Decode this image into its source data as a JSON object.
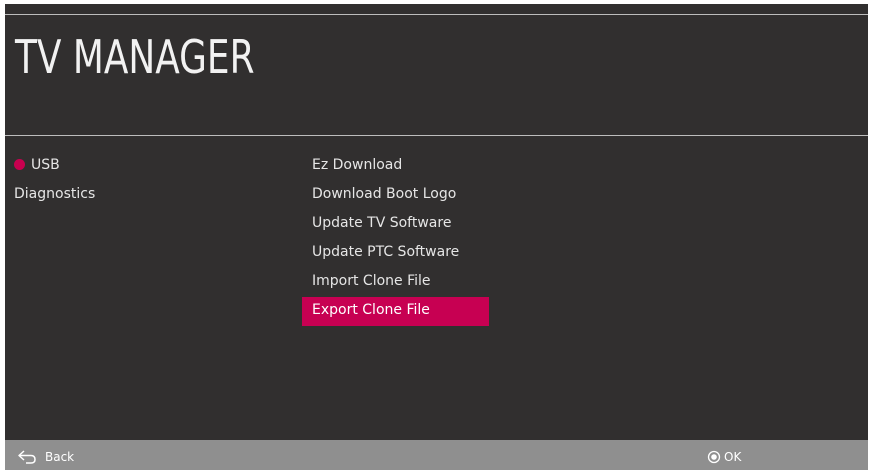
{
  "header": {
    "title": "TV MANAGER"
  },
  "left_menu": {
    "items": [
      {
        "label": "USB",
        "active": true,
        "indicator_color": "#c8004f"
      },
      {
        "label": "Diagnostics",
        "active": false
      }
    ]
  },
  "right_menu": {
    "items": [
      {
        "label": "Ez Download",
        "selected": false
      },
      {
        "label": "Download Boot Logo",
        "selected": false
      },
      {
        "label": "Update TV Software",
        "selected": false
      },
      {
        "label": "Update PTC Software",
        "selected": false
      },
      {
        "label": "Import Clone File",
        "selected": false
      },
      {
        "label": "Export Clone File",
        "selected": true
      }
    ],
    "selected_color": "#c70052"
  },
  "footer": {
    "back_label": "Back",
    "back_icon": "back-arrow-icon",
    "ok_label": "OK",
    "ok_icon": "ok-circle-icon"
  },
  "colors": {
    "background": "#312f2f",
    "footer": "#8f8f8f",
    "accent": "#c70052"
  }
}
